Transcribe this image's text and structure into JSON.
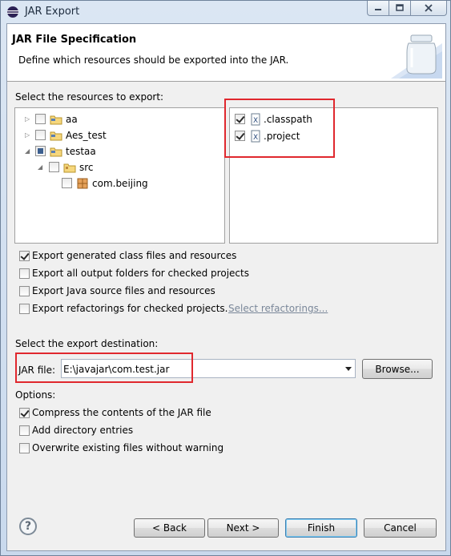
{
  "window": {
    "title": "JAR Export",
    "controls": {
      "minimize": "minimize",
      "maximize": "maximize",
      "close": "close"
    }
  },
  "header": {
    "title": "JAR File Specification",
    "description": "Define which resources should be exported into the JAR."
  },
  "resources": {
    "label": "Select the resources to export:",
    "tree": [
      {
        "label": "aa",
        "checked": false,
        "expanded": false,
        "icon": "project-folder-icon"
      },
      {
        "label": "Aes_test",
        "checked": false,
        "expanded": false,
        "icon": "project-folder-icon"
      },
      {
        "label": "testaa",
        "checked": "partial",
        "expanded": true,
        "icon": "project-folder-icon"
      },
      {
        "label": "src",
        "checked": false,
        "expanded": true,
        "icon": "source-folder-icon"
      },
      {
        "label": "com.beijing",
        "checked": false,
        "icon": "package-icon"
      }
    ],
    "files": [
      {
        "label": ".classpath",
        "checked": true,
        "icon": "xml-file-icon"
      },
      {
        "label": ".project",
        "checked": true,
        "icon": "xml-file-icon"
      }
    ]
  },
  "options_export": [
    {
      "label": "Export generated class files and resources",
      "checked": true
    },
    {
      "label": "Export all output folders for checked projects",
      "checked": false
    },
    {
      "label": "Export Java source files and resources",
      "checked": false
    },
    {
      "label": "Export refactorings for checked projects.",
      "checked": false
    }
  ],
  "select_refactorings_link": "Select refactorings...",
  "destination": {
    "label": "Select the export destination:",
    "jar_label": "JAR file:",
    "jar_value": "E:\\javajar\\com.test.jar",
    "browse_label": "Browse..."
  },
  "options": {
    "label": "Options:",
    "items": [
      {
        "label": "Compress the contents of the JAR file",
        "checked": true
      },
      {
        "label": "Add directory entries",
        "checked": false
      },
      {
        "label": "Overwrite existing files without warning",
        "checked": false
      }
    ]
  },
  "buttons": {
    "help": "?",
    "back": "< Back",
    "next": "Next >",
    "finish": "Finish",
    "cancel": "Cancel"
  },
  "colors": {
    "highlight_box": "#e0282e",
    "link": "#7a8799"
  }
}
